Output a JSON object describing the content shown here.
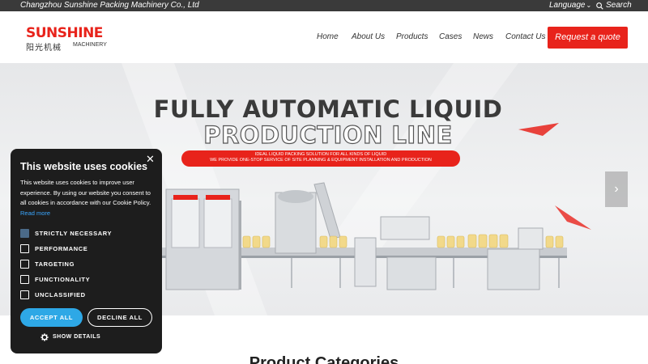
{
  "topbar": {
    "company": "Changzhou Sunshine Packing Machinery Co., Ltd",
    "language": "Language",
    "search": "Search"
  },
  "header": {
    "logo": {
      "brand": "SUNSHINE",
      "chinese": "阳光机械",
      "sub": "MACHINERY"
    },
    "nav": [
      "Home",
      "About Us",
      "Products",
      "Cases",
      "News",
      "Contact Us"
    ],
    "quote_button": "Request a quote"
  },
  "hero": {
    "title_line1": "FULLY AUTOMATIC LIQUID",
    "title_line2": "PRODUCTION LINE",
    "banner_line1": "IDEAL LIQUID PACKING SOLUTION FOR ALL KINDS OF LIQUID",
    "banner_line2": "WE PROVIDE ONE-STOP SERVICE OF SITE PLANNING & EQUIPMENT INSTALLATION AND PRODUCTION",
    "next_arrow": "›"
  },
  "section_title": "Product Categories",
  "cookie": {
    "title": "This website uses cookies",
    "body": "This website uses cookies to improve user experience. By using our website you consent to all cookies in accordance with our Cookie Policy.",
    "read_more": "Read more",
    "options": [
      {
        "label": "STRICTLY NECESSARY",
        "checked": true
      },
      {
        "label": "PERFORMANCE",
        "checked": false
      },
      {
        "label": "TARGETING",
        "checked": false
      },
      {
        "label": "FUNCTIONALITY",
        "checked": false
      },
      {
        "label": "UNCLASSIFIED",
        "checked": false
      }
    ],
    "accept": "ACCEPT ALL",
    "decline": "DECLINE ALL",
    "details": "SHOW DETAILS"
  },
  "colors": {
    "accent": "#e8231b",
    "topbar": "#3a3a3a",
    "popup": "#1d1d1d",
    "accept": "#2ea8e6",
    "link": "#3aa7ff"
  }
}
